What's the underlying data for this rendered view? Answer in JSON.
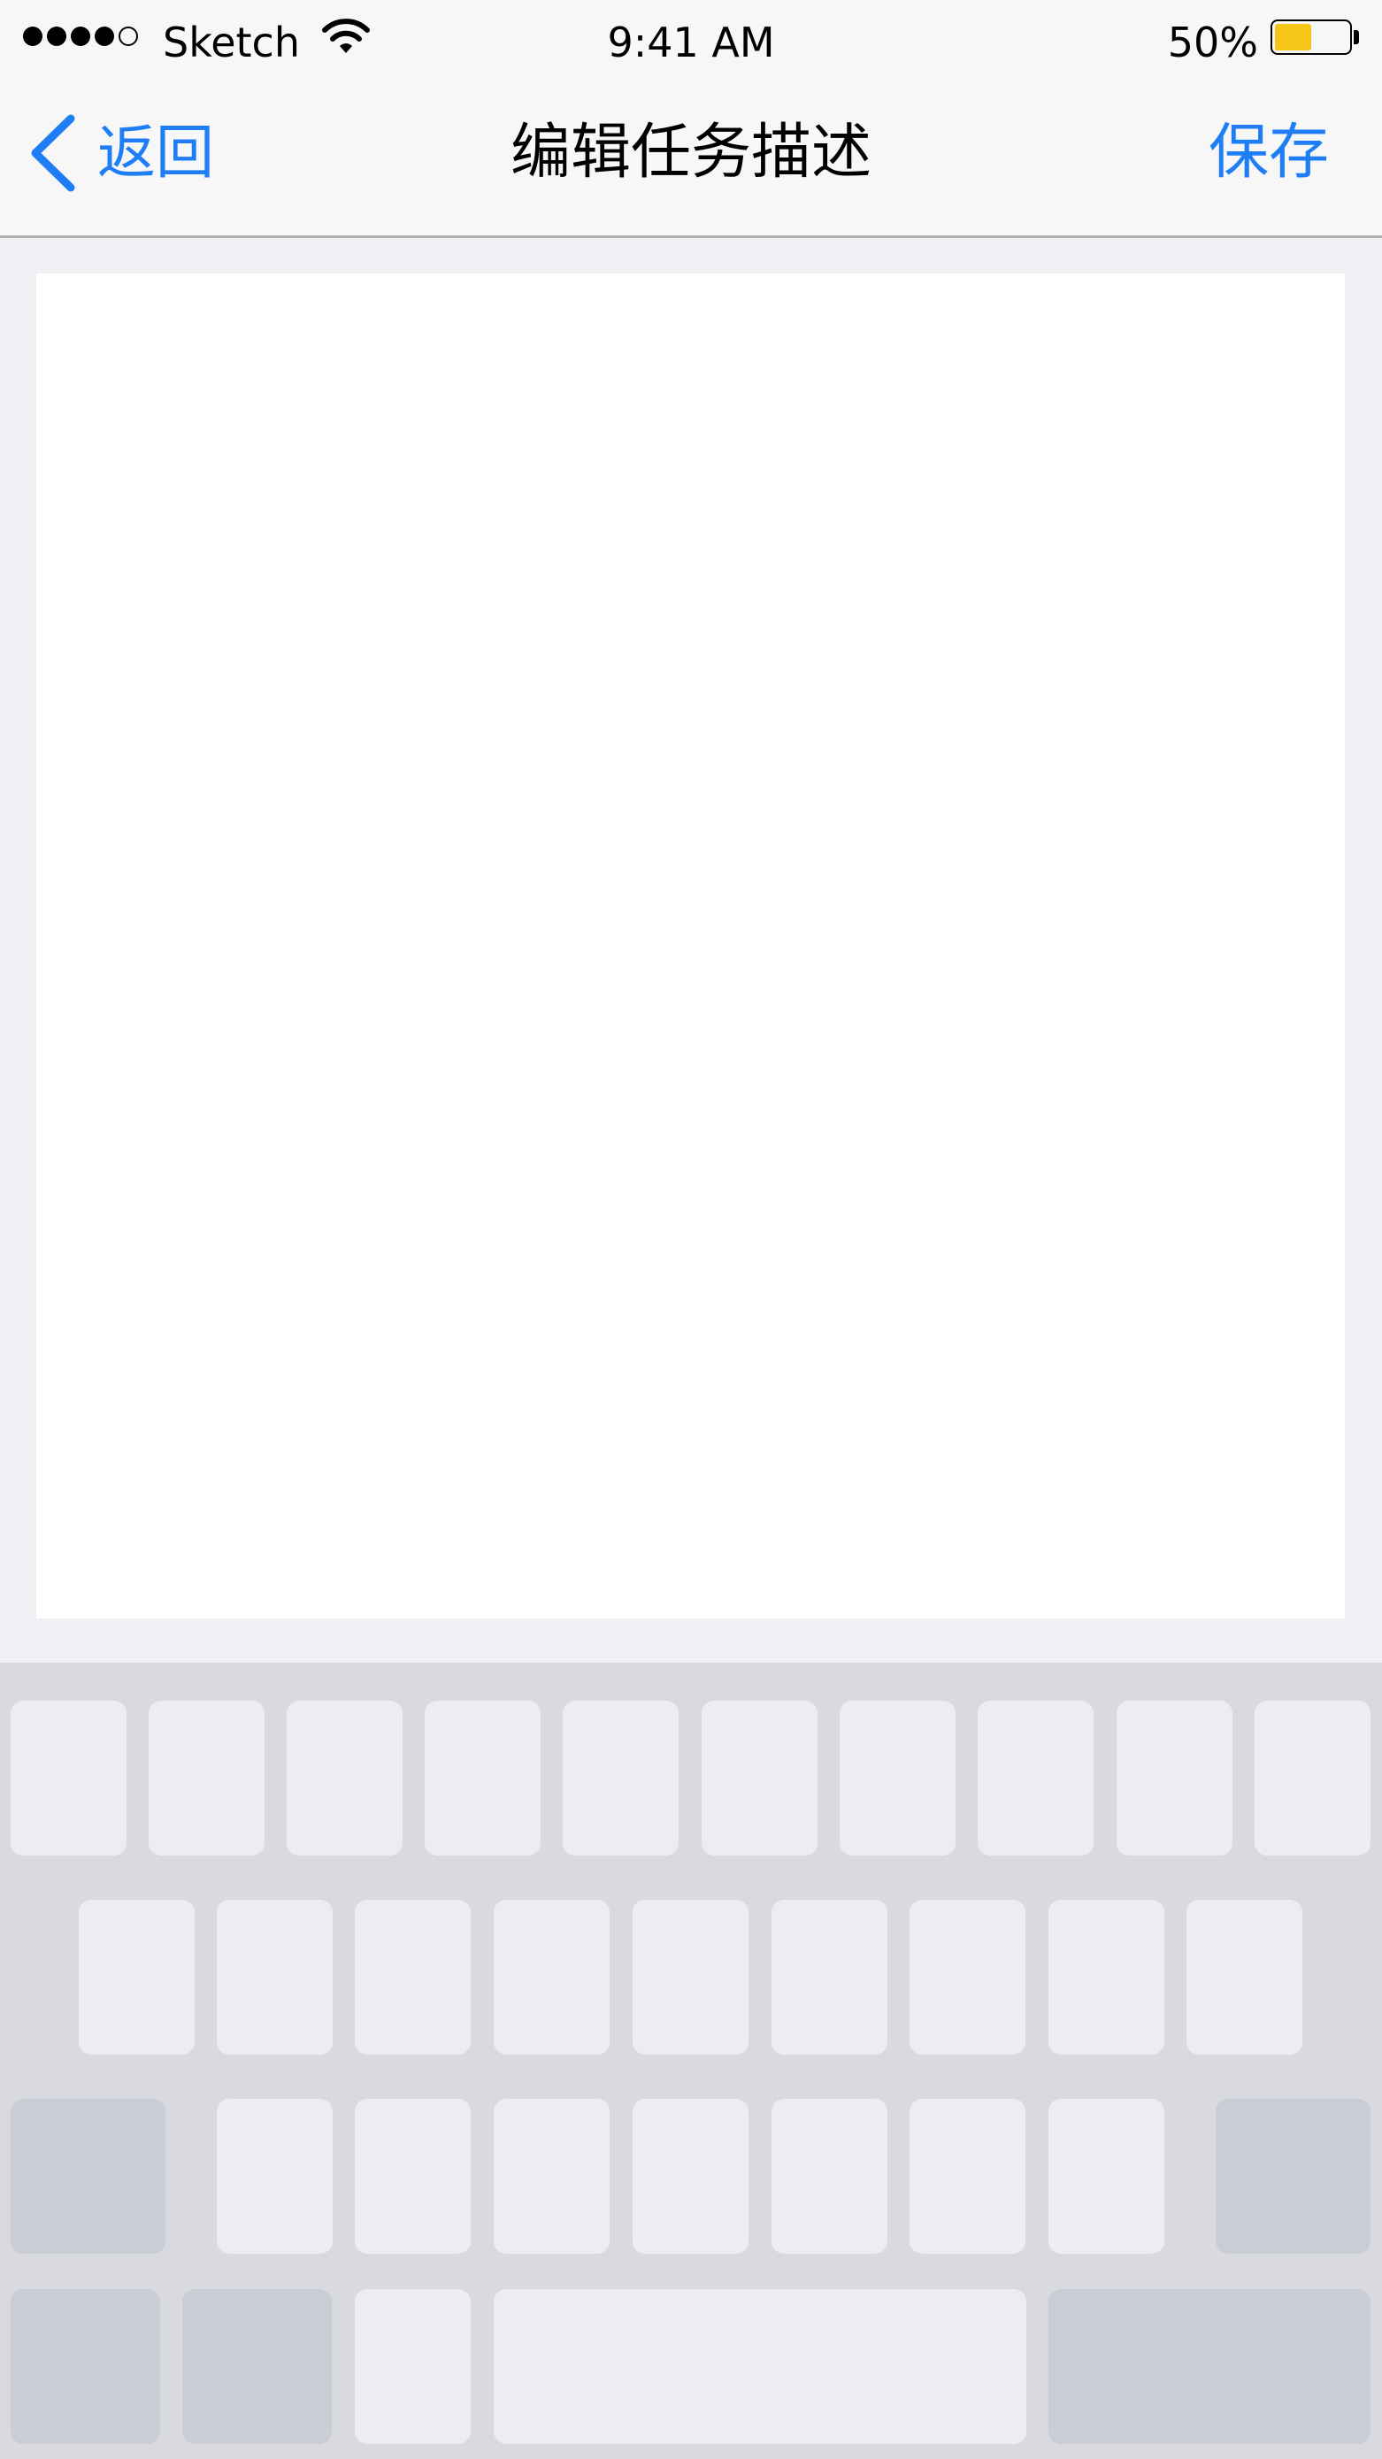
{
  "status_bar": {
    "carrier": "Sketch",
    "time": "9:41 AM",
    "battery_percent": "50%",
    "battery_level": 0.5,
    "signal_bars_filled": 4,
    "signal_bars_total": 5,
    "wifi_icon": "wifi-icon",
    "battery_color": "#f5c518"
  },
  "nav": {
    "back_label": "返回",
    "back_icon": "chevron-left-icon",
    "title": "编辑任务描述",
    "save_label": "保存",
    "accent_color": "#1f7ef5"
  },
  "editor": {
    "value": "",
    "placeholder": ""
  },
  "keyboard": {
    "background": "#d8dadf",
    "key_light": "#ebedf0",
    "key_dark": "#cacdd5",
    "rows": [
      {
        "keys": 10
      },
      {
        "keys": 9
      },
      {
        "keys": 9
      },
      {
        "keys": 5
      }
    ]
  }
}
